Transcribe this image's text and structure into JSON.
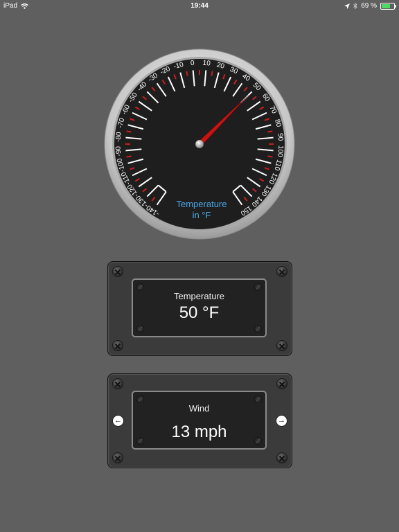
{
  "status_bar": {
    "device": "iPad",
    "time": "19:44",
    "battery": "69 %",
    "battery_level": 0.69
  },
  "gauge": {
    "label_line1": "Temperature",
    "label_line2": "in °F",
    "value": 50,
    "min": -140,
    "max": 150,
    "major_step": 10,
    "colors": {
      "bezel": "#d0d0d0",
      "face": "#1e1e1e",
      "ticks": "#ffffff",
      "minor_ticks": "#cc1f1f",
      "needle": "#cc1111",
      "label": "#4aa8e8"
    }
  },
  "temperature_panel": {
    "label": "Temperature",
    "value": "50 °F"
  },
  "wind_panel": {
    "label": "Wind",
    "value": "13 mph"
  },
  "icons": {
    "wifi": "wifi-icon",
    "location": "location-arrow-icon",
    "bluetooth": "bluetooth-icon",
    "arrow_left": "←",
    "arrow_right": "→"
  }
}
